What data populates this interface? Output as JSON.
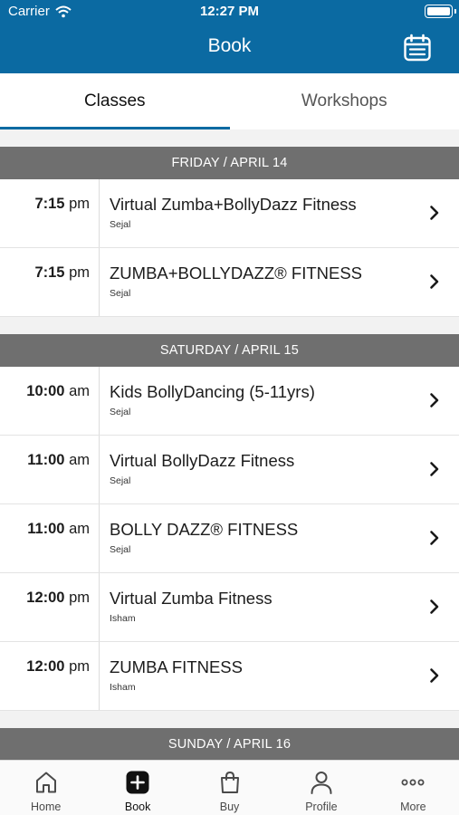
{
  "status_bar": {
    "carrier": "Carrier",
    "time": "12:27 PM"
  },
  "nav": {
    "title": "Book",
    "calendar_icon": "calendar-icon"
  },
  "tabs": [
    {
      "label": "Classes",
      "active": true
    },
    {
      "label": "Workshops",
      "active": false
    }
  ],
  "days": [
    {
      "header": "FRIDAY / APRIL 14",
      "classes": [
        {
          "time_num": "7:15",
          "time_ampm": " pm",
          "name": "Virtual Zumba+BollyDazz Fitness",
          "teacher": "Sejal"
        },
        {
          "time_num": "7:15",
          "time_ampm": " pm",
          "name": "ZUMBA+BOLLYDAZZ® FITNESS",
          "teacher": "Sejal"
        }
      ]
    },
    {
      "header": "SATURDAY / APRIL 15",
      "classes": [
        {
          "time_num": "10:00",
          "time_ampm": " am",
          "name": "Kids BollyDancing (5-11yrs)",
          "teacher": "Sejal"
        },
        {
          "time_num": "11:00",
          "time_ampm": " am",
          "name": "Virtual BollyDazz Fitness",
          "teacher": "Sejal"
        },
        {
          "time_num": "11:00",
          "time_ampm": " am",
          "name": "BOLLY DAZZ® FITNESS",
          "teacher": "Sejal"
        },
        {
          "time_num": "12:00",
          "time_ampm": " pm",
          "name": "Virtual Zumba Fitness",
          "teacher": "Isham"
        },
        {
          "time_num": "12:00",
          "time_ampm": " pm",
          "name": "ZUMBA FITNESS",
          "teacher": "Isham"
        }
      ]
    },
    {
      "header": "SUNDAY / APRIL 16",
      "classes": []
    }
  ],
  "tabbar": [
    {
      "label": "Home",
      "icon": "home-icon",
      "active": false
    },
    {
      "label": "Book",
      "icon": "plus-square-icon",
      "active": true
    },
    {
      "label": "Buy",
      "icon": "shopping-bag-icon",
      "active": false
    },
    {
      "label": "Profile",
      "icon": "person-icon",
      "active": false
    },
    {
      "label": "More",
      "icon": "more-dots-icon",
      "active": false
    }
  ],
  "colors": {
    "brand": "#0b6aa2",
    "day_header_bg": "#6f6f6f"
  }
}
